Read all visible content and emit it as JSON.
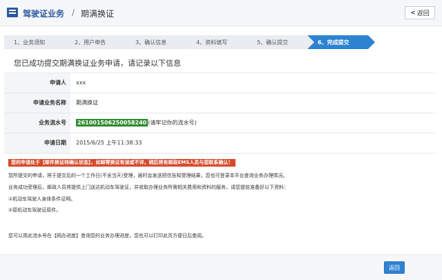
{
  "header": {
    "breadcrumb_main": "驾驶证业务",
    "breadcrumb_sep": "/",
    "breadcrumb_sub": "期满换证",
    "back_label": "返回",
    "back_icon": "<"
  },
  "steps": [
    {
      "label": "1、业务须知"
    },
    {
      "label": "2、用户申告"
    },
    {
      "label": "3、确认信息"
    },
    {
      "label": "4、资料填写"
    },
    {
      "label": "5、确认提交"
    },
    {
      "label": "6、完成提交"
    }
  ],
  "notice_title": "您已成功提交期满换证业务申请，请记录以下信息",
  "info": {
    "applicant_label": "申请人",
    "applicant_value": "xxx",
    "business_name_label": "申请业务名称",
    "business_name_value": "期满换证",
    "serial_label": "业务流水号",
    "serial_value": "26100150625005824​0",
    "serial_hint": "(请牢记你的流水号)",
    "date_label": "申请日期",
    "date_value": "2015/6/25 上午11:38:33"
  },
  "alert_text": "您的申请处于【邮件换证待确认状态】，如邮寄换证有误或不详，稍后将有邮政EMS人员与您联系确认！",
  "desc_lines": [
    "您所提交的申请，将于提交后的一个工作日(不含当天)受理，届时会发送短信告知受理结果，您也可登录本平台查询业务办理情况。",
    "业务成功受理后，邮政人员将提供上门送达机动车驾驶证，并收取办理业务所需相关费用和资料的服务，请您提前准备好以下资料：",
    "①机动车驾驶人身体条件证明。",
    "②原机动车驾驶证原件。",
    "您可以用此流水号在【网办进度】查询您的业务办理进度，您也可以打印此页方便日后查阅。"
  ],
  "footer": {
    "back_label": "返回"
  }
}
